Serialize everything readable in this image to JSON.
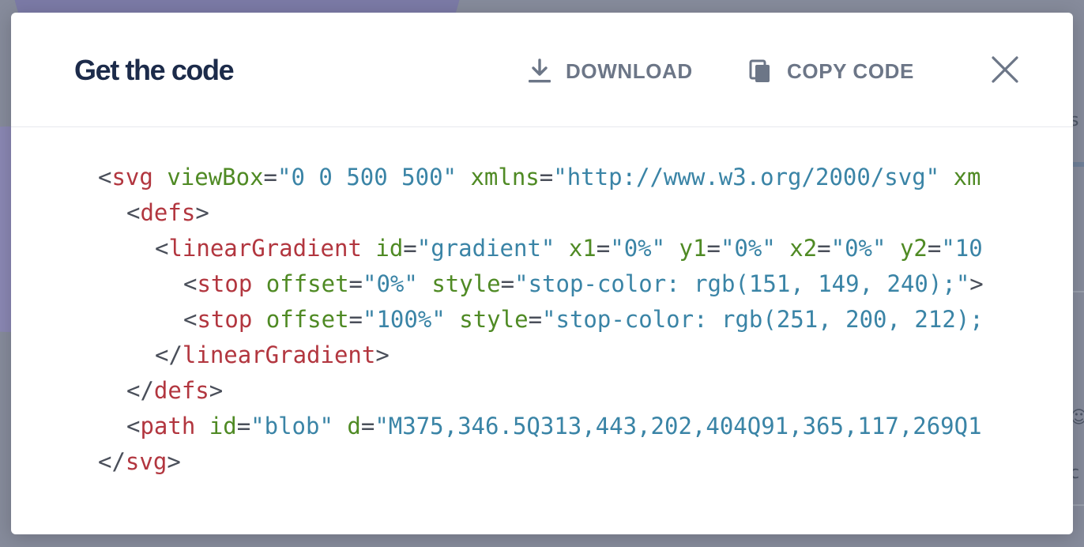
{
  "modal": {
    "title": "Get the code",
    "download_label": "DOWNLOAD",
    "copy_label": "COPY CODE"
  },
  "code": {
    "lines": [
      {
        "indent": 0,
        "tokens": [
          {
            "t": "punc",
            "v": "<"
          },
          {
            "t": "tag",
            "v": "svg"
          },
          {
            "t": "plain",
            "v": " "
          },
          {
            "t": "attr",
            "v": "viewBox"
          },
          {
            "t": "punc",
            "v": "="
          },
          {
            "t": "val",
            "v": "\"0 0 500 500\""
          },
          {
            "t": "plain",
            "v": " "
          },
          {
            "t": "attr",
            "v": "xmlns"
          },
          {
            "t": "punc",
            "v": "="
          },
          {
            "t": "val",
            "v": "\"http://www.w3.org/2000/svg\""
          },
          {
            "t": "plain",
            "v": " "
          },
          {
            "t": "attr",
            "v": "xm"
          }
        ]
      },
      {
        "indent": 2,
        "tokens": [
          {
            "t": "punc",
            "v": "<"
          },
          {
            "t": "tag",
            "v": "defs"
          },
          {
            "t": "punc",
            "v": ">"
          }
        ]
      },
      {
        "indent": 4,
        "tokens": [
          {
            "t": "punc",
            "v": "<"
          },
          {
            "t": "tag",
            "v": "linearGradient"
          },
          {
            "t": "plain",
            "v": " "
          },
          {
            "t": "attr",
            "v": "id"
          },
          {
            "t": "punc",
            "v": "="
          },
          {
            "t": "val",
            "v": "\"gradient\""
          },
          {
            "t": "plain",
            "v": " "
          },
          {
            "t": "attr",
            "v": "x1"
          },
          {
            "t": "punc",
            "v": "="
          },
          {
            "t": "val",
            "v": "\"0%\""
          },
          {
            "t": "plain",
            "v": " "
          },
          {
            "t": "attr",
            "v": "y1"
          },
          {
            "t": "punc",
            "v": "="
          },
          {
            "t": "val",
            "v": "\"0%\""
          },
          {
            "t": "plain",
            "v": " "
          },
          {
            "t": "attr",
            "v": "x2"
          },
          {
            "t": "punc",
            "v": "="
          },
          {
            "t": "val",
            "v": "\"0%\""
          },
          {
            "t": "plain",
            "v": " "
          },
          {
            "t": "attr",
            "v": "y2"
          },
          {
            "t": "punc",
            "v": "="
          },
          {
            "t": "val",
            "v": "\"10"
          }
        ]
      },
      {
        "indent": 6,
        "tokens": [
          {
            "t": "punc",
            "v": "<"
          },
          {
            "t": "tag",
            "v": "stop"
          },
          {
            "t": "plain",
            "v": " "
          },
          {
            "t": "attr",
            "v": "offset"
          },
          {
            "t": "punc",
            "v": "="
          },
          {
            "t": "val",
            "v": "\"0%\""
          },
          {
            "t": "plain",
            "v": " "
          },
          {
            "t": "attr",
            "v": "style"
          },
          {
            "t": "punc",
            "v": "="
          },
          {
            "t": "val",
            "v": "\"stop-color: rgb(151, 149, 240);\""
          },
          {
            "t": "punc",
            "v": ">"
          }
        ]
      },
      {
        "indent": 6,
        "tokens": [
          {
            "t": "punc",
            "v": "<"
          },
          {
            "t": "tag",
            "v": "stop"
          },
          {
            "t": "plain",
            "v": " "
          },
          {
            "t": "attr",
            "v": "offset"
          },
          {
            "t": "punc",
            "v": "="
          },
          {
            "t": "val",
            "v": "\"100%\""
          },
          {
            "t": "plain",
            "v": " "
          },
          {
            "t": "attr",
            "v": "style"
          },
          {
            "t": "punc",
            "v": "="
          },
          {
            "t": "val",
            "v": "\"stop-color: rgb(251, 200, 212);"
          }
        ]
      },
      {
        "indent": 4,
        "tokens": [
          {
            "t": "punc",
            "v": "</"
          },
          {
            "t": "tag",
            "v": "linearGradient"
          },
          {
            "t": "punc",
            "v": ">"
          }
        ]
      },
      {
        "indent": 2,
        "tokens": [
          {
            "t": "punc",
            "v": "</"
          },
          {
            "t": "tag",
            "v": "defs"
          },
          {
            "t": "punc",
            "v": ">"
          }
        ]
      },
      {
        "indent": 2,
        "tokens": [
          {
            "t": "punc",
            "v": "<"
          },
          {
            "t": "tag",
            "v": "path"
          },
          {
            "t": "plain",
            "v": " "
          },
          {
            "t": "attr",
            "v": "id"
          },
          {
            "t": "punc",
            "v": "="
          },
          {
            "t": "val",
            "v": "\"blob\""
          },
          {
            "t": "plain",
            "v": " "
          },
          {
            "t": "attr",
            "v": "d"
          },
          {
            "t": "punc",
            "v": "="
          },
          {
            "t": "val",
            "v": "\"M375,346.5Q313,443,202,404Q91,365,117,269Q1"
          }
        ]
      },
      {
        "indent": 0,
        "tokens": [
          {
            "t": "punc",
            "v": "</"
          },
          {
            "t": "tag",
            "v": "svg"
          },
          {
            "t": "punc",
            "v": ">"
          }
        ]
      }
    ]
  },
  "icons": {
    "download": "download-icon",
    "copy": "copy-icon",
    "close": "close-icon"
  },
  "colors": {
    "title": "#1c2b4a",
    "button_text": "#6c7687",
    "tag": "#b2363f",
    "attribute": "#4f8a24",
    "value": "#3a84a6",
    "backdrop": "#868b9b"
  }
}
